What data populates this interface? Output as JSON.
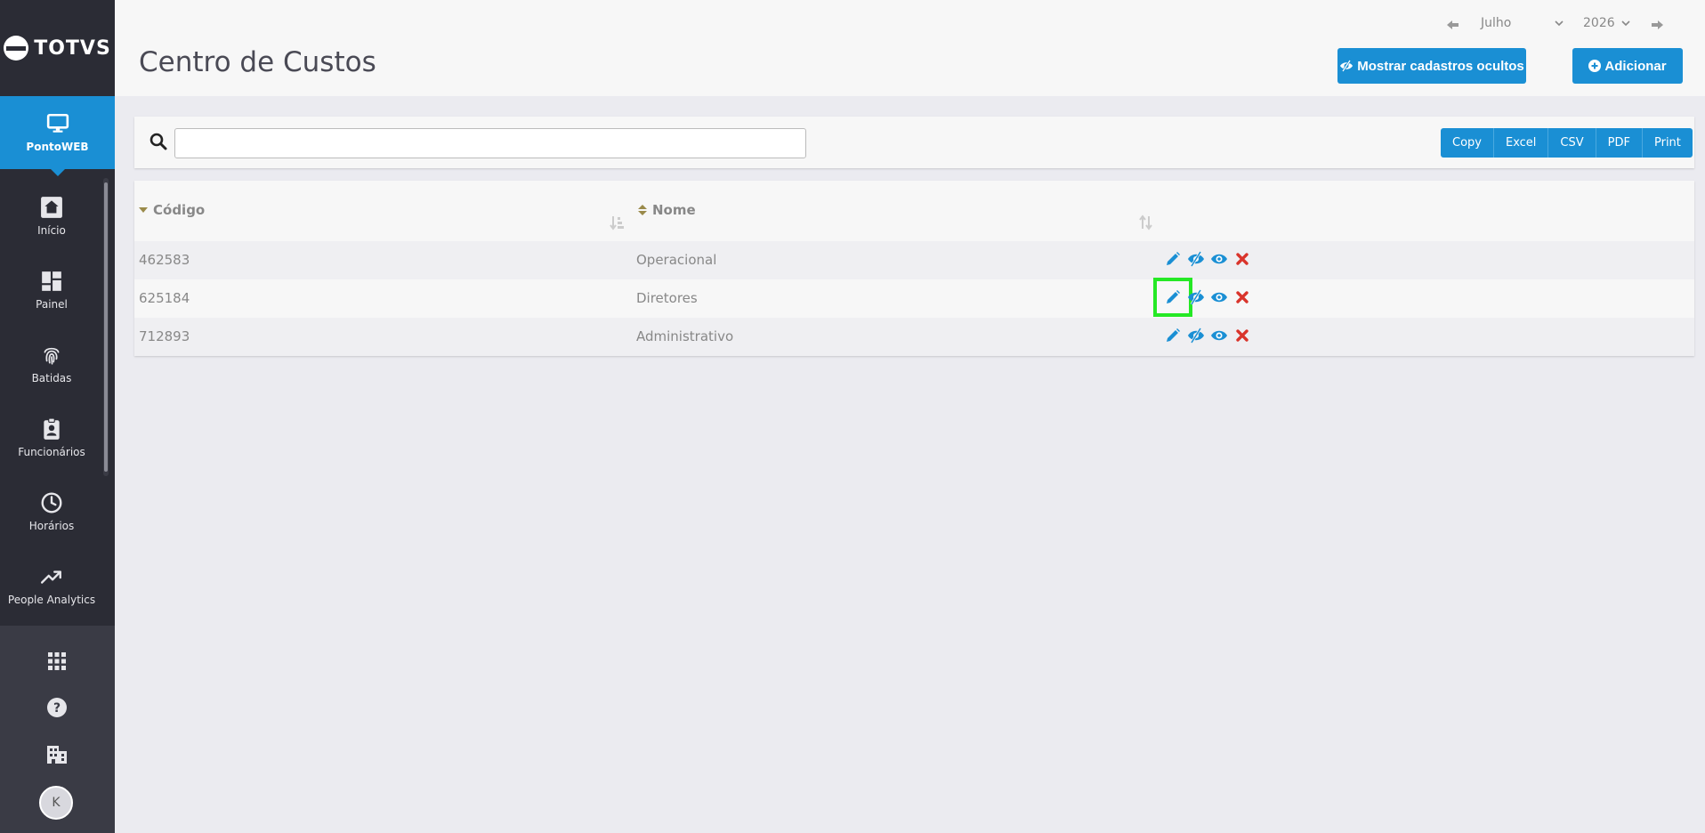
{
  "brand": {
    "logo_text": "TOTVS"
  },
  "sidebar": {
    "active": {
      "label": "PontoWEB",
      "icon": "monitor-icon"
    },
    "items": [
      {
        "label": "Início",
        "icon": "home-icon"
      },
      {
        "label": "Painel",
        "icon": "dashboard-icon"
      },
      {
        "label": "Batidas",
        "icon": "fingerprint-icon"
      },
      {
        "label": "Funcionários",
        "icon": "badge-icon"
      },
      {
        "label": "Horários",
        "icon": "clock-icon"
      },
      {
        "label": "People Analytics",
        "icon": "trend-icon"
      }
    ],
    "bottom": [
      {
        "icon": "apps-grid-icon"
      },
      {
        "icon": "help-icon"
      },
      {
        "icon": "building-icon"
      }
    ],
    "avatar_initial": "K"
  },
  "header": {
    "title": "Centro de Custos",
    "month": "Julho",
    "year": "2026",
    "show_hidden_label": "Mostrar cadastros ocultos",
    "add_label": "Adicionar"
  },
  "toolbar": {
    "search_value": "",
    "export_buttons": [
      "Copy",
      "Excel",
      "CSV",
      "PDF",
      "Print"
    ]
  },
  "table": {
    "columns": [
      "Código",
      "Nome"
    ],
    "rows": [
      {
        "codigo": "462583",
        "nome": "Operacional"
      },
      {
        "codigo": "625184",
        "nome": "Diretores"
      },
      {
        "codigo": "712893",
        "nome": "Administrativo"
      }
    ]
  },
  "colors": {
    "accent": "#1a8fd4",
    "sidebar": "#2b2c35",
    "delete": "#d9342b",
    "highlight": "#25e825"
  }
}
